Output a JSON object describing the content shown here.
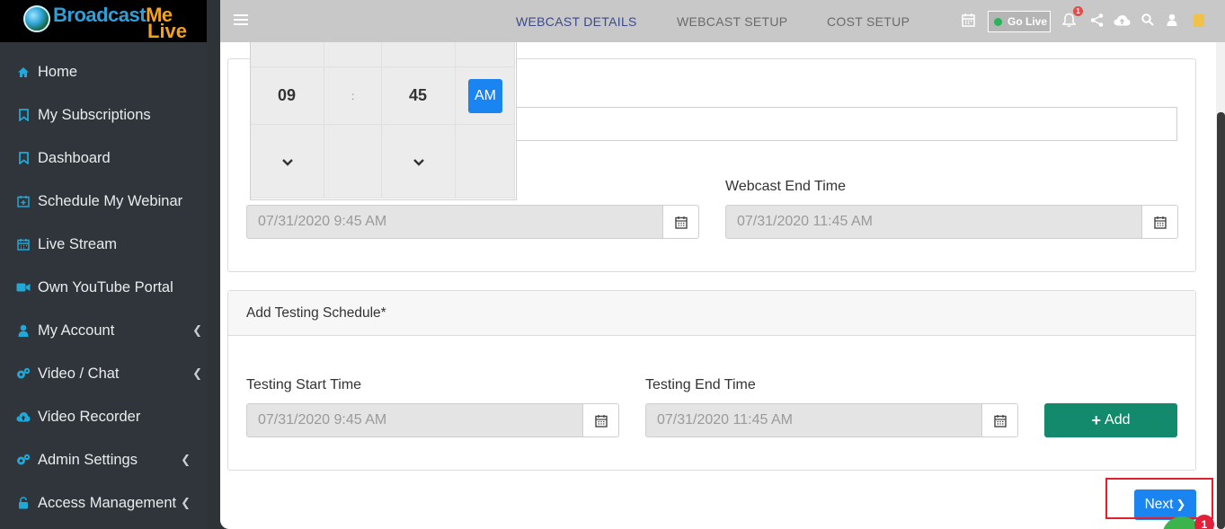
{
  "app": {
    "logo_word1": "Broadcast",
    "logo_word2": "Me",
    "logo_word3": "Live"
  },
  "sidebar": {
    "items": [
      {
        "label": "Home",
        "icon": "home-icon"
      },
      {
        "label": "My Subscriptions",
        "icon": "bookmark-icon"
      },
      {
        "label": "Dashboard",
        "icon": "bookmark-icon"
      },
      {
        "label": "Schedule My Webinar",
        "icon": "calendar-plus-icon"
      },
      {
        "label": "Live Stream",
        "icon": "calendar-icon"
      },
      {
        "label": "Own YouTube Portal",
        "icon": "video-camera-icon"
      },
      {
        "label": "My Account",
        "icon": "user-icon",
        "expandable": true
      },
      {
        "label": "Video / Chat",
        "icon": "gears-icon",
        "expandable": true
      },
      {
        "label": "Video Recorder",
        "icon": "cloud-upload-icon"
      },
      {
        "label": "Admin Settings",
        "icon": "gears-icon",
        "expandable": true
      },
      {
        "label": "Access Management",
        "icon": "lock-icon",
        "expandable": true
      }
    ]
  },
  "topbar": {
    "tabs": [
      {
        "label": "WEBCAST DETAILS",
        "active": true
      },
      {
        "label": "WEBCAST SETUP",
        "active": false
      },
      {
        "label": "COST SETUP",
        "active": false
      }
    ],
    "go_live_label": "Go Live",
    "notification_count": "1"
  },
  "time_picker": {
    "hour": "09",
    "separator": ":",
    "minute": "45",
    "period": "AM"
  },
  "webcast": {
    "end_time_label": "Webcast End Time",
    "start_time_value": "07/31/2020 9:45 AM",
    "end_time_value": "07/31/2020 11:45 AM"
  },
  "testing": {
    "header": "Add Testing Schedule*",
    "start_label": "Testing Start Time",
    "end_label": "Testing End Time",
    "start_value": "07/31/2020 9:45 AM",
    "end_value": "07/31/2020 11:45 AM",
    "add_label": "Add"
  },
  "next_label": "Next",
  "chat_badge_count": "1",
  "colors": {
    "sidebar": "#2f353a",
    "accent_blue": "#1a84f0",
    "add_green": "#138a6c",
    "highlight_red": "#e0202a"
  }
}
